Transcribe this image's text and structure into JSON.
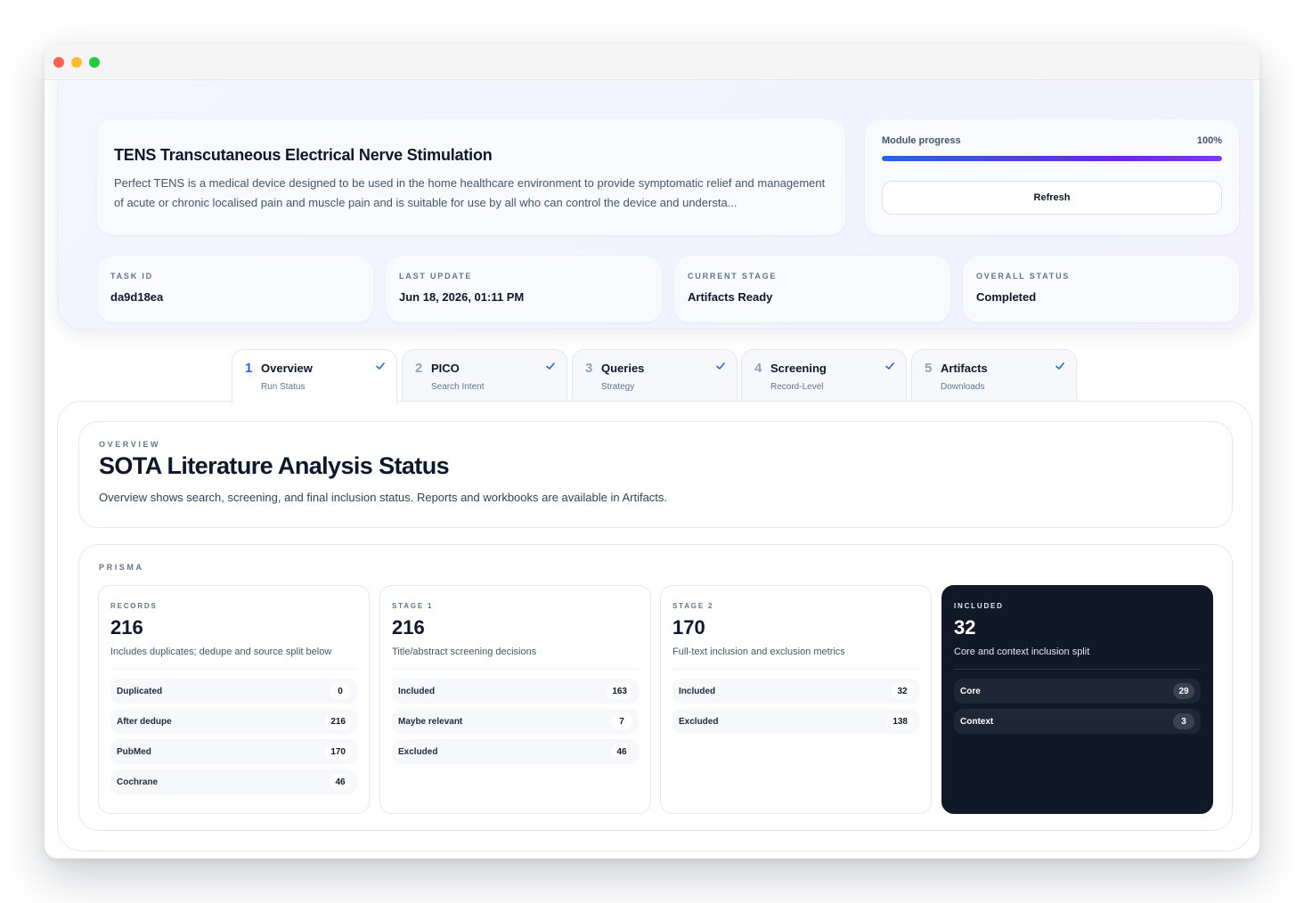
{
  "device": {
    "title": "TENS Transcutaneous Electrical Nerve Stimulation",
    "description": "Perfect TENS is a medical device designed to be used in the home healthcare environment to provide symptomatic relief and management of acute or chronic localised pain and muscle pain and is suitable for use by all who can control the device and understa..."
  },
  "progress": {
    "label": "Module progress",
    "percent_text": "100%",
    "value": 1.0,
    "refresh_label": "Refresh"
  },
  "stats": [
    {
      "label": "TASK ID",
      "value": "da9d18ea"
    },
    {
      "label": "LAST UPDATE",
      "value": "Jun 18, 2026, 01:11 PM"
    },
    {
      "label": "CURRENT STAGE",
      "value": "Artifacts Ready"
    },
    {
      "label": "OVERALL STATUS",
      "value": "Completed"
    }
  ],
  "tabs": [
    {
      "num": "1",
      "label": "Overview",
      "sub": "Run Status",
      "icon": "check-icon"
    },
    {
      "num": "2",
      "label": "PICO",
      "sub": "Search Intent",
      "icon": "check-icon"
    },
    {
      "num": "3",
      "label": "Queries",
      "sub": "Strategy",
      "icon": "check-icon"
    },
    {
      "num": "4",
      "label": "Screening",
      "sub": "Record-Level",
      "icon": "check-icon"
    },
    {
      "num": "5",
      "label": "Artifacts",
      "sub": "Downloads",
      "icon": "check-icon"
    }
  ],
  "overview": {
    "eyebrow": "OVERVIEW",
    "title": "SOTA Literature Analysis Status",
    "description": "Overview shows search, screening, and final inclusion status. Reports and workbooks are available in Artifacts."
  },
  "prisma": {
    "eyebrow": "PRISMA",
    "cards": [
      {
        "eyebrow": "RECORDS",
        "value": "216",
        "description": "Includes duplicates; dedupe and source split below",
        "rows": [
          {
            "label": "Duplicated",
            "value": "0"
          },
          {
            "label": "After dedupe",
            "value": "216"
          },
          {
            "label": "PubMed",
            "value": "170"
          },
          {
            "label": "Cochrane",
            "value": "46"
          }
        ]
      },
      {
        "eyebrow": "STAGE 1",
        "value": "216",
        "description": "Title/abstract screening decisions",
        "rows": [
          {
            "label": "Included",
            "value": "163"
          },
          {
            "label": "Maybe relevant",
            "value": "7"
          },
          {
            "label": "Excluded",
            "value": "46"
          }
        ]
      },
      {
        "eyebrow": "STAGE 2",
        "value": "170",
        "description": "Full-text inclusion and exclusion metrics",
        "rows": [
          {
            "label": "Included",
            "value": "32"
          },
          {
            "label": "Excluded",
            "value": "138"
          }
        ]
      },
      {
        "eyebrow": "INCLUDED",
        "value": "32",
        "description": "Core and context inclusion split",
        "rows": [
          {
            "label": "Core",
            "value": "29"
          },
          {
            "label": "Context",
            "value": "3"
          }
        ]
      }
    ]
  },
  "colors": {
    "accent": "#2563eb",
    "progress_gradient_start": "#2563eb",
    "progress_gradient_end": "#7c3aed",
    "dark_card": "#111827"
  }
}
